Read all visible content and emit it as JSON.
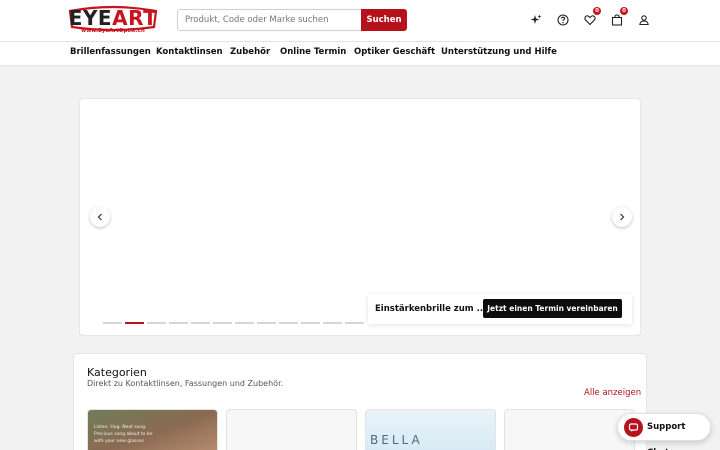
{
  "header": {
    "logo": {
      "brand_left": "EYE",
      "brand_right": "ART",
      "url": "www.EyeArtOptik.ch"
    },
    "search": {
      "placeholder": "Produkt, Code oder Marke suchen",
      "value": "",
      "button_label": "Suchen"
    },
    "icons": [
      {
        "name": "sparkle-icon"
      },
      {
        "name": "help-icon"
      },
      {
        "name": "heart-icon",
        "badge": "0"
      },
      {
        "name": "bag-icon",
        "badge": "0"
      },
      {
        "name": "user-icon"
      }
    ],
    "accent_color": "#b5121b"
  },
  "nav": {
    "items": [
      "Brillenfassungen",
      "Kontaktlinsen",
      "Zubehör",
      "Online Termin",
      "Optiker Geschäft",
      "Unterstützung und Hilfe"
    ]
  },
  "hero": {
    "promo_text": "Einstärkenbrille zum ...",
    "promo_button": "Jetzt einen Termin vereinbaren",
    "dot_count": 12,
    "active_dot": 1
  },
  "categories": {
    "title": "Kategorien",
    "subtitle": "Direkt zu Kontaktlinsen, Fassungen und Zubehör.",
    "show_all": "Alle anzeigen",
    "card1_text": [
      "Listen. Hug. Next song.",
      "Precious song about to be",
      "with your new glasses"
    ],
    "card3_text": "BELLA"
  },
  "support_chat": {
    "label": "Support Chat"
  }
}
